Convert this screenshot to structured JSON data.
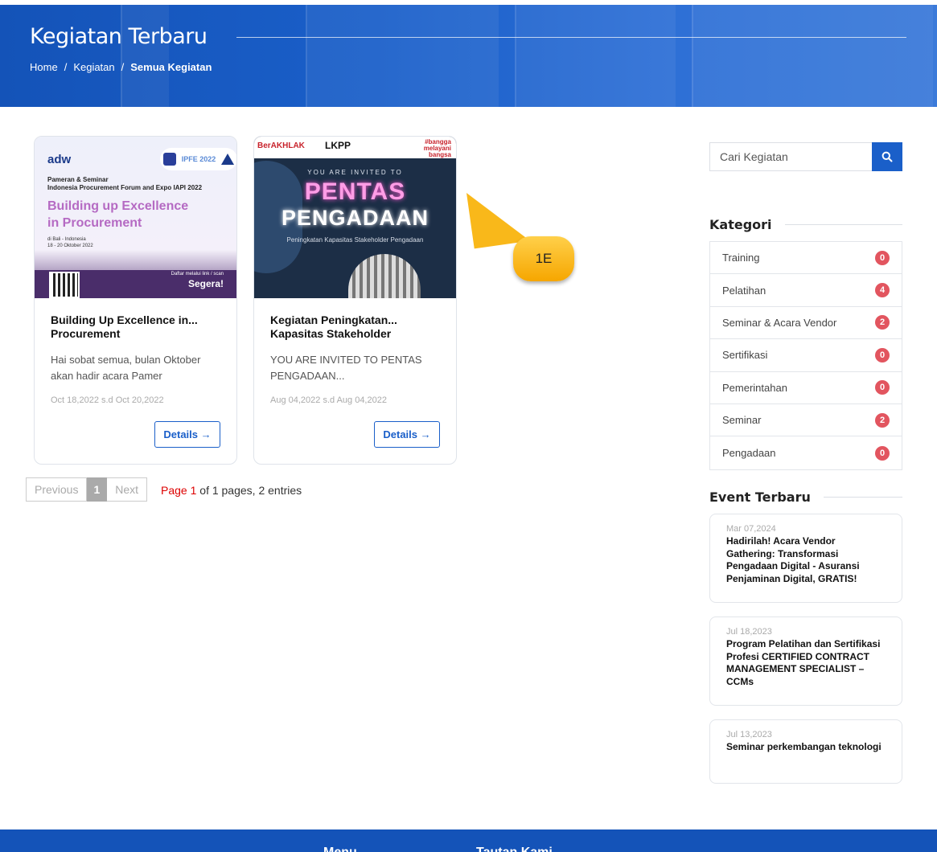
{
  "header": {
    "title": "Kegiatan Terbaru",
    "breadcrumb": {
      "home": "Home",
      "kegiatan": "Kegiatan",
      "current": "Semua Kegiatan",
      "separator": "/"
    }
  },
  "cards": [
    {
      "title": "Building Up Excellence in... Procurement",
      "description": "Hai sobat semua, bulan Oktober akan hadir acara Pamer",
      "date": "Oct 18,2022 s.d Oct 20,2022",
      "details_label": "Details →",
      "thumb": {
        "brand": "adw",
        "logo_text": "IPFE 2022",
        "subtitle_1": "Pameran & Seminar",
        "subtitle_2": "Indonesia Procurement Forum and Expo IAPI 2022",
        "headline_1": "Building up Excellence",
        "headline_2": "in Procurement",
        "location": "di Bali - Indonesia",
        "dates": "18 - 20 Oktober 2022",
        "cta_small": "Daftar melalui link / scan",
        "cta_big": "Segera!"
      }
    },
    {
      "title": "Kegiatan Peningkatan... Kapasitas Stakeholder",
      "description": "YOU ARE INVITED TO PENTAS PENGADAAN...",
      "date": "Aug 04,2022 s.d Aug 04,2022",
      "details_label": "Details →",
      "thumb": {
        "berakhlak": "BerAKHLAK",
        "lkpp": "LKPP",
        "hashtag_1": "#bangga",
        "hashtag_2": "melayani",
        "hashtag_3": "bangsa",
        "invite": "YOU ARE INVITED TO",
        "pentas": "PENTAS",
        "pengadaan": "PENGADAAN",
        "tagline": "Peningkatan Kapasitas Stakeholder Pengadaan"
      }
    }
  ],
  "pagination": {
    "previous": "Previous",
    "current": "1",
    "next": "Next",
    "info_prefix": "Page",
    "info_page": "1",
    "info_suffix": "of 1 pages, 2 entries"
  },
  "callout": {
    "label": "1E",
    "color": "#f6a600"
  },
  "sidebar": {
    "search_placeholder": "Cari Kegiatan",
    "kategori_title": "Kategori",
    "categories": [
      {
        "label": "Training",
        "count": "0"
      },
      {
        "label": "Pelatihan",
        "count": "4"
      },
      {
        "label": "Seminar & Acara Vendor",
        "count": "2"
      },
      {
        "label": "Sertifikasi",
        "count": "0"
      },
      {
        "label": "Pemerintahan",
        "count": "0"
      },
      {
        "label": "Seminar",
        "count": "2"
      },
      {
        "label": "Pengadaan",
        "count": "0"
      }
    ],
    "event_title": "Event Terbaru",
    "events": [
      {
        "date": "Mar 07,2024",
        "title": "Hadirilah! Acara Vendor Gathering: Transformasi Pengadaan Digital - Asuransi Penjaminan Digital, GRATIS!"
      },
      {
        "date": "Jul 18,2023",
        "title": "Program Pelatihan dan Sertifikasi Profesi CERTIFIED CONTRACT MANAGEMENT SPECIALIST – CCMs"
      },
      {
        "date": "Jul 13,2023",
        "title": "Seminar perkembangan teknologi"
      }
    ]
  },
  "footer": {
    "menu_title": "Menu",
    "links_title": "Tautan Kami"
  },
  "colors": {
    "brand_blue": "#1a5fc9",
    "badge_red": "#e2555f",
    "callout_yellow": "#f6a600"
  }
}
